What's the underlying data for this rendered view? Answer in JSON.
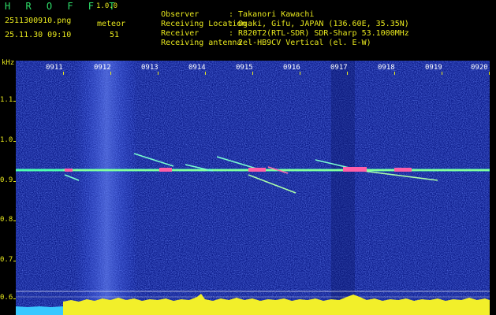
{
  "app": {
    "title": "H R O F F T",
    "version": "1.0.0"
  },
  "file": {
    "name": "2511300910.png",
    "datetime": "25.11.30 09:10"
  },
  "meteor": {
    "label": "meteor",
    "count": "51"
  },
  "info": [
    {
      "label": "Observer",
      "value": ": Takanori Kawachi"
    },
    {
      "label": "Receiving Location",
      "value": ": Ogaki, Gifu, JAPAN (136.60E, 35.35N)"
    },
    {
      "label": "Receiver",
      "value": ": R820T2(RTL-SDR) SDR-Sharp 53.1000MHz"
    },
    {
      "label": "Receiving antenna",
      "value": ": 2el-HB9CV Vertical (el. E-W)"
    }
  ],
  "axis": {
    "unit": "kHz",
    "y_labels": [
      "1.1",
      "1.0",
      "0.9",
      "0.8",
      "0.7",
      "0.6"
    ],
    "x_labels": [
      "0911",
      "0912",
      "0913",
      "0914",
      "0915",
      "0916",
      "0917",
      "0918",
      "0919",
      "0920"
    ]
  },
  "colors": {
    "background": "#000000",
    "spectrum": "#0d1d8c",
    "label_yellow": "#e8e81e",
    "title_green": "#2ee06a",
    "carrier": "#4dffb0"
  }
}
